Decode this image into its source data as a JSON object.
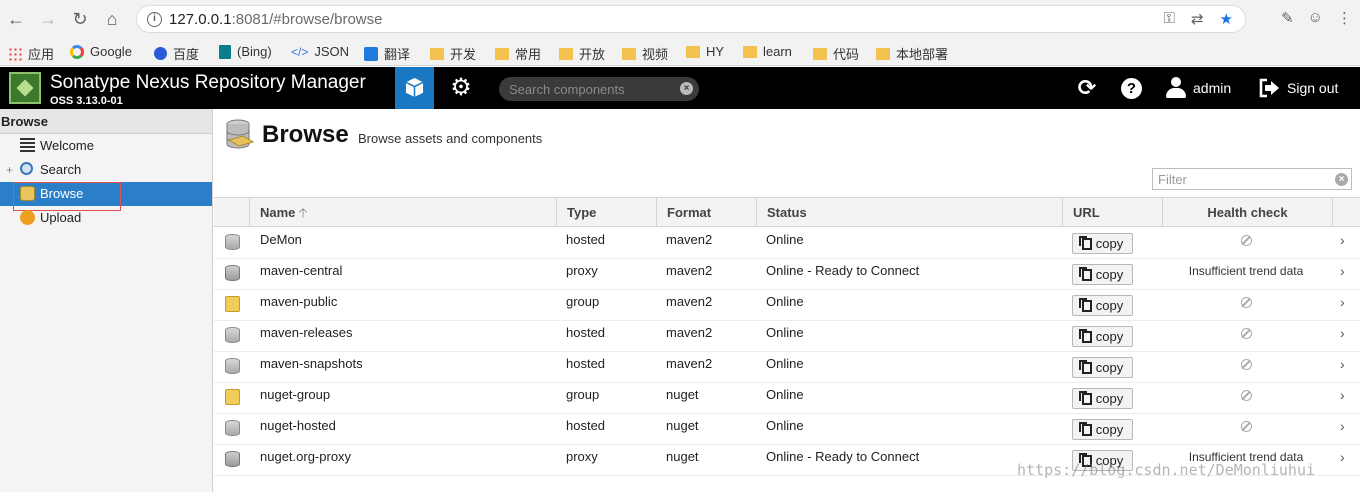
{
  "browser": {
    "url_host": "127.0.0.1",
    "url_rest": ":8081/#browse/browse",
    "bookmarks": [
      {
        "label": "应用",
        "icon": "apps-grid-icon"
      },
      {
        "label": "Google",
        "icon": "google-icon"
      },
      {
        "label": "百度",
        "icon": "baidu-paw-icon"
      },
      {
        "label": "(Bing)",
        "icon": "bing-icon"
      },
      {
        "label": "JSON",
        "icon": "code-icon"
      },
      {
        "label": "翻译",
        "icon": "translate-icon"
      },
      {
        "label": "开发",
        "icon": "folder-icon"
      },
      {
        "label": "常用",
        "icon": "folder-icon"
      },
      {
        "label": "开放",
        "icon": "folder-icon"
      },
      {
        "label": "视频",
        "icon": "folder-icon"
      },
      {
        "label": "HY",
        "icon": "folder-icon"
      },
      {
        "label": "learn",
        "icon": "folder-icon"
      },
      {
        "label": "代码",
        "icon": "folder-icon"
      },
      {
        "label": "本地部署",
        "icon": "folder-icon"
      }
    ]
  },
  "header": {
    "title": "Sonatype Nexus Repository Manager",
    "version": "OSS 3.13.0-01",
    "search_placeholder": "Search components",
    "user": "admin",
    "signout": "Sign out"
  },
  "sidebar": {
    "heading": "Browse",
    "items": [
      {
        "label": "Welcome",
        "selected": false
      },
      {
        "label": "Search",
        "selected": false
      },
      {
        "label": "Browse",
        "selected": true
      },
      {
        "label": "Upload",
        "selected": false
      }
    ]
  },
  "page": {
    "title": "Browse",
    "subtitle": "Browse assets and components",
    "filter_placeholder": "Filter"
  },
  "table": {
    "columns": [
      "Name",
      "Type",
      "Format",
      "Status",
      "URL",
      "Health check"
    ],
    "copy_label": "copy",
    "rows": [
      {
        "name": "DeMon",
        "type": "hosted",
        "format": "maven2",
        "status": "Online",
        "health": ""
      },
      {
        "name": "maven-central",
        "type": "proxy",
        "format": "maven2",
        "status": "Online - Ready to Connect",
        "health": "Insufficient trend data"
      },
      {
        "name": "maven-public",
        "type": "group",
        "format": "maven2",
        "status": "Online",
        "health": ""
      },
      {
        "name": "maven-releases",
        "type": "hosted",
        "format": "maven2",
        "status": "Online",
        "health": ""
      },
      {
        "name": "maven-snapshots",
        "type": "hosted",
        "format": "maven2",
        "status": "Online",
        "health": ""
      },
      {
        "name": "nuget-group",
        "type": "group",
        "format": "nuget",
        "status": "Online",
        "health": ""
      },
      {
        "name": "nuget-hosted",
        "type": "hosted",
        "format": "nuget",
        "status": "Online",
        "health": ""
      },
      {
        "name": "nuget.org-proxy",
        "type": "proxy",
        "format": "nuget",
        "status": "Online - Ready to Connect",
        "health": "Insufficient trend data"
      }
    ]
  },
  "watermark": "https://blog.csdn.net/DeMonliuhui"
}
